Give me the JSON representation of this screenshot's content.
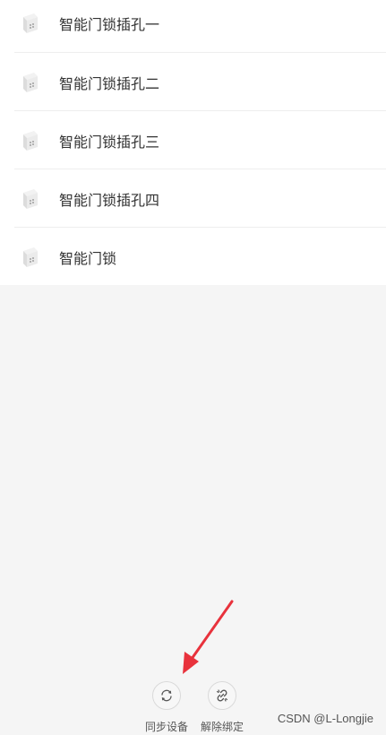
{
  "devices": [
    {
      "name": "智能门锁插孔一",
      "icon": "smart-socket-icon"
    },
    {
      "name": "智能门锁插孔二",
      "icon": "smart-socket-icon"
    },
    {
      "name": "智能门锁插孔三",
      "icon": "smart-socket-icon"
    },
    {
      "name": "智能门锁插孔四",
      "icon": "smart-socket-icon"
    },
    {
      "name": "智能门锁",
      "icon": "smart-socket-icon"
    }
  ],
  "actions": {
    "sync": {
      "label": "同步设备",
      "icon": "sync-icon"
    },
    "unbind": {
      "label": "解除绑定",
      "icon": "unlink-icon"
    }
  },
  "annotation": {
    "color": "#e8323c",
    "icon": "red-arrow"
  },
  "watermark": "CSDN @L-Longjie"
}
